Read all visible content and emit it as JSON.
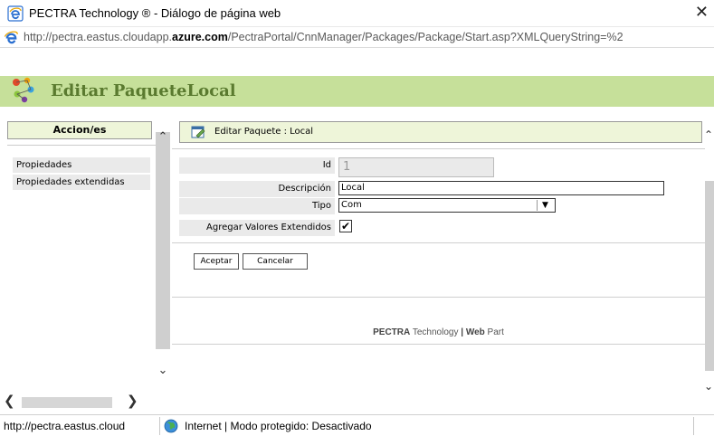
{
  "window": {
    "title": "PECTRA Technology ® - Diálogo de página web",
    "close_glyph": "✕",
    "icon": "ie-page-icon"
  },
  "address": {
    "url_prefix": "http://pectra.eastus.cloudapp.",
    "url_domain": "azure.com",
    "url_suffix": "/PectraPortal/CnnManager/Packages/Package/Start.asp?XMLQueryString=%2",
    "icon": "ie-e-icon"
  },
  "header": {
    "title": "Editar PaqueteLocal",
    "logo": "pectra-logo-icon",
    "color": "#c6e09a"
  },
  "left": {
    "header": "Accion/es",
    "items": [
      {
        "label": "Propiedades"
      },
      {
        "label": "Propiedades extendidas"
      }
    ],
    "scroll_up": "⌃",
    "scroll_down": "⌄",
    "scroll_left": "❮",
    "scroll_right": "❯"
  },
  "panel": {
    "title": "Editar Paquete : Local",
    "icon": "edit-icon"
  },
  "form": {
    "id_label": "Id",
    "id_value": "1",
    "desc_label": "Descripción",
    "desc_value": "Local",
    "tipo_label": "Tipo",
    "tipo_value": "Com",
    "ext_label": "Agregar Valores Extendidos",
    "ext_checked": "✔"
  },
  "buttons": {
    "accept": "Aceptar",
    "cancel": "Cancelar"
  },
  "footer": {
    "brand": "PECTRA",
    "tech": " Technology",
    "bar": " | ",
    "web": "Web",
    "part": " Part"
  },
  "status": {
    "url": "http://pectra.eastus.cloud",
    "zone": "Internet | Modo protegido: Desactivado",
    "icon": "globe-icon"
  }
}
